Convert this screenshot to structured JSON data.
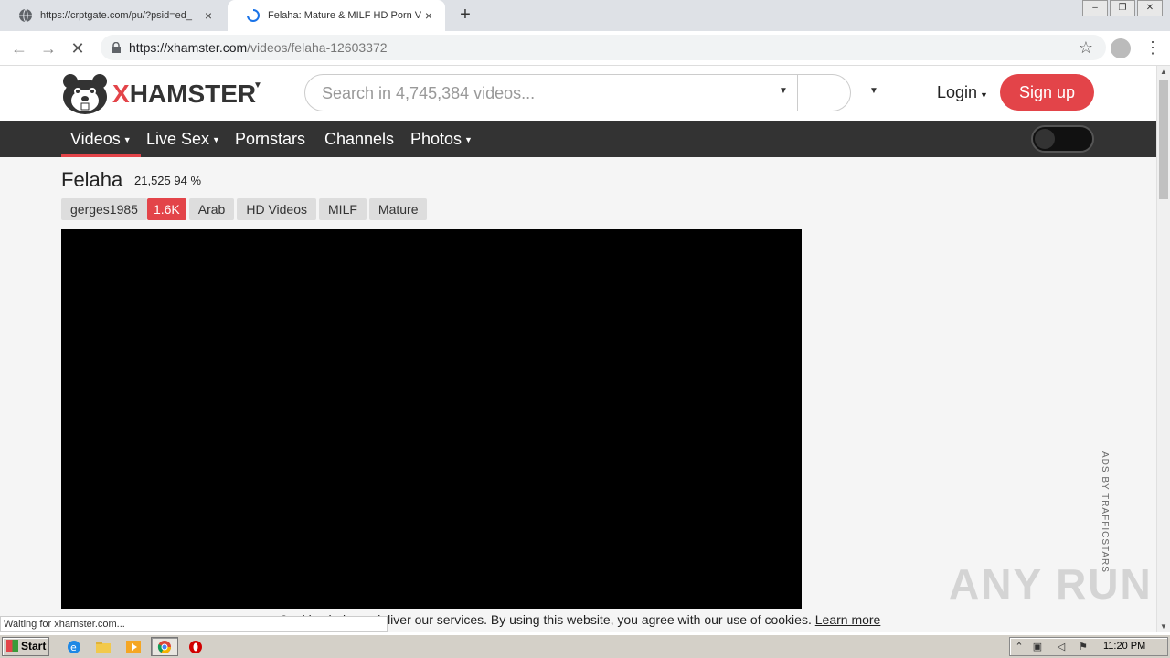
{
  "browser": {
    "tabs": [
      {
        "title": "https://crptgate.com/pu/?psid=ed_",
        "close": "×"
      },
      {
        "title": "Felaha: Mature & MILF HD Porn Vide",
        "close": "×"
      }
    ],
    "new_tab": "+",
    "url_host": "https://xhamster.com",
    "url_path": "/videos/felaha-12603372",
    "status": "Waiting for xhamster.com..."
  },
  "site": {
    "brand_x": "X",
    "brand_rest": "HAMSTER",
    "search_placeholder": "Search in 4,745,384 videos...",
    "login": "Login",
    "signup": "Sign up",
    "nav": [
      "Videos",
      "Live Sex",
      "Pornstars",
      "Channels",
      "Photos"
    ]
  },
  "video": {
    "title": "Felaha",
    "stats": "21,525 94 %",
    "uploader": "gerges1985",
    "uploader_count": "1.6K",
    "tags": [
      "Arab",
      "HD Videos",
      "MILF",
      "Mature"
    ]
  },
  "ads_label": "ADS BY TRAFFICSTARS",
  "cookie": {
    "text": "Cookies help us deliver our services. By using this website, you agree with our use of cookies.",
    "link": "Learn more"
  },
  "watermark": "ANY RUN",
  "taskbar": {
    "start": "Start",
    "clock": "11:20 PM"
  },
  "colors": {
    "accent": "#e34449",
    "navbar": "#333333"
  }
}
